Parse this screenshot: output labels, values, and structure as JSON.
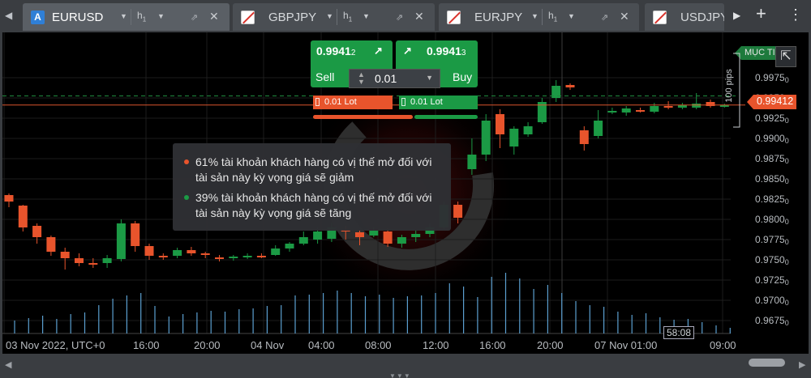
{
  "tabs": [
    {
      "icon": "a-icon",
      "icon_text": "A",
      "name": "EURUSD",
      "timeframe": "h",
      "tf_sub": "1",
      "active": true
    },
    {
      "icon": "flag-icon",
      "name": "GBPJPY",
      "timeframe": "h",
      "tf_sub": "1",
      "active": false
    },
    {
      "icon": "flag-icon",
      "name": "EURJPY",
      "timeframe": "h",
      "tf_sub": "1",
      "active": false
    },
    {
      "icon": "flag-icon",
      "name": "USDJPY",
      "active": false
    }
  ],
  "toolbar": {
    "back_glyph": "◀",
    "next_glyph": "▶",
    "add_glyph": "+",
    "menu_glyph": "⋮"
  },
  "trade": {
    "sell_price_main": "0.9941",
    "sell_price_small": "2",
    "buy_price_main": "0.9941",
    "buy_price_small": "3",
    "sell_label": "Sell",
    "buy_label": "Buy",
    "quantity": "0.01",
    "sell_lot": "0.01 Lot",
    "buy_lot": "0.01 Lot",
    "sell_share": 61,
    "buy_share": 39,
    "colors": {
      "buy": "#1b9a45",
      "sell": "#e8542c"
    }
  },
  "sentiment": {
    "sell_text": "61% tài khoản khách hàng có vị thế mở đối với tài sản này kỳ vọng giá sẽ giảm",
    "buy_text": "39% tài khoản khách hàng có vị thế mở đối với tài sản này kỳ vọng giá sẽ tăng"
  },
  "price_axis": {
    "current_price": "0.99412",
    "take_profit_label": "MỤC TI",
    "pips_label": "100 pips",
    "ticks": [
      {
        "main": "0.9975",
        "small": "0",
        "v": 0.9975
      },
      {
        "main": "0.9950",
        "small": "0",
        "v": 0.995
      },
      {
        "main": "0.9925",
        "small": "0",
        "v": 0.9925
      },
      {
        "main": "0.9900",
        "small": "0",
        "v": 0.99
      },
      {
        "main": "0.9875",
        "small": "0",
        "v": 0.9875
      },
      {
        "main": "0.9850",
        "small": "0",
        "v": 0.985
      },
      {
        "main": "0.9825",
        "small": "0",
        "v": 0.9825
      },
      {
        "main": "0.9800",
        "small": "0",
        "v": 0.98
      },
      {
        "main": "0.9775",
        "small": "0",
        "v": 0.9775
      },
      {
        "main": "0.9750",
        "small": "0",
        "v": 0.975
      },
      {
        "main": "0.9725",
        "small": "0",
        "v": 0.9725
      },
      {
        "main": "0.9700",
        "small": "0",
        "v": 0.97
      },
      {
        "main": "0.9675",
        "small": "0",
        "v": 0.9675
      }
    ]
  },
  "time_axis": [
    "03 Nov 2022, UTC+0",
    "16:00",
    "20:00",
    "04 Nov",
    "04:00",
    "08:00",
    "12:00",
    "16:00",
    "20:00",
    "07 Nov 01:00",
    "09:00"
  ],
  "countdown": "58:08",
  "chart_data": {
    "type": "candlestick",
    "symbol": "EURUSD",
    "timeframe": "h1",
    "ylim": [
      0.9655,
      0.9995
    ],
    "current_price": 0.99412,
    "take_profit": 0.99525,
    "candles": [
      [
        0.983,
        0.9822,
        0.9832,
        0.9815
      ],
      [
        0.9817,
        0.979,
        0.9818,
        0.9785
      ],
      [
        0.9792,
        0.9778,
        0.9795,
        0.977
      ],
      [
        0.9778,
        0.976,
        0.978,
        0.9755
      ],
      [
        0.976,
        0.9752,
        0.9765,
        0.9738
      ],
      [
        0.9752,
        0.9746,
        0.9758,
        0.9742
      ],
      [
        0.9746,
        0.9745,
        0.9752,
        0.974
      ],
      [
        0.9746,
        0.9752,
        0.9756,
        0.974
      ],
      [
        0.9751,
        0.9795,
        0.98,
        0.9748
      ],
      [
        0.9795,
        0.9767,
        0.9798,
        0.976
      ],
      [
        0.9767,
        0.9755,
        0.977,
        0.975
      ],
      [
        0.9755,
        0.9754,
        0.9758,
        0.975
      ],
      [
        0.9755,
        0.9762,
        0.9765,
        0.9752
      ],
      [
        0.9762,
        0.9758,
        0.9766,
        0.9755
      ],
      [
        0.9758,
        0.9756,
        0.976,
        0.9752
      ],
      [
        0.9753,
        0.9752,
        0.9756,
        0.9748
      ],
      [
        0.9752,
        0.9754,
        0.9756,
        0.9749
      ],
      [
        0.9753,
        0.9755,
        0.9758,
        0.9751
      ],
      [
        0.9755,
        0.9754,
        0.9758,
        0.9752
      ],
      [
        0.9756,
        0.9764,
        0.9768,
        0.9755
      ],
      [
        0.9764,
        0.977,
        0.9772,
        0.976
      ],
      [
        0.977,
        0.9778,
        0.9785,
        0.9768
      ],
      [
        0.9775,
        0.9785,
        0.979,
        0.977
      ],
      [
        0.9776,
        0.979,
        0.9796,
        0.9772
      ],
      [
        0.9788,
        0.9785,
        0.9792,
        0.9775
      ],
      [
        0.9784,
        0.9778,
        0.9788,
        0.9768
      ],
      [
        0.978,
        0.9786,
        0.979,
        0.9778
      ],
      [
        0.9785,
        0.977,
        0.9789,
        0.9766
      ],
      [
        0.977,
        0.9778,
        0.9781,
        0.9765
      ],
      [
        0.9778,
        0.9782,
        0.9786,
        0.9772
      ],
      [
        0.9782,
        0.979,
        0.9795,
        0.9778
      ],
      [
        0.979,
        0.9818,
        0.9822,
        0.9788
      ],
      [
        0.9818,
        0.9802,
        0.9822,
        0.9795
      ],
      [
        0.9862,
        0.988,
        0.99,
        0.9855
      ],
      [
        0.988,
        0.9922,
        0.993,
        0.9872
      ],
      [
        0.993,
        0.9905,
        0.9936,
        0.9888
      ],
      [
        0.989,
        0.9912,
        0.9915,
        0.988
      ],
      [
        0.9905,
        0.9915,
        0.992,
        0.9902
      ],
      [
        0.992,
        0.9945,
        0.995,
        0.9918
      ],
      [
        0.995,
        0.9965,
        0.9972,
        0.9945
      ],
      [
        0.9966,
        0.9963,
        0.9968,
        0.996
      ],
      [
        0.991,
        0.9893,
        0.9915,
        0.9885
      ],
      [
        0.9903,
        0.9922,
        0.9935,
        0.99
      ],
      [
        0.9934,
        0.9934,
        0.9938,
        0.993
      ],
      [
        0.9932,
        0.9937,
        0.994,
        0.9928
      ],
      [
        0.9935,
        0.9934,
        0.9938,
        0.9932
      ],
      [
        0.9933,
        0.994,
        0.9944,
        0.9931
      ],
      [
        0.994,
        0.9939,
        0.9946,
        0.9936
      ],
      [
        0.9938,
        0.9941,
        0.9944,
        0.9936
      ],
      [
        0.9938,
        0.9943,
        0.9956,
        0.9936
      ],
      [
        0.9945,
        0.994,
        0.9948,
        0.9938
      ],
      [
        0.9941,
        0.9941,
        0.9943,
        0.9938
      ]
    ],
    "volume": [
      16,
      19,
      22,
      18,
      24,
      26,
      35,
      43,
      47,
      50,
      34,
      21,
      24,
      26,
      28,
      27,
      30,
      31,
      34,
      35,
      47,
      48,
      50,
      53,
      50,
      46,
      48,
      44,
      46,
      47,
      50,
      62,
      58,
      45,
      70,
      75,
      68,
      55,
      60,
      50,
      40,
      35,
      33,
      27,
      23,
      25,
      20,
      17,
      18,
      14,
      10,
      7
    ]
  }
}
